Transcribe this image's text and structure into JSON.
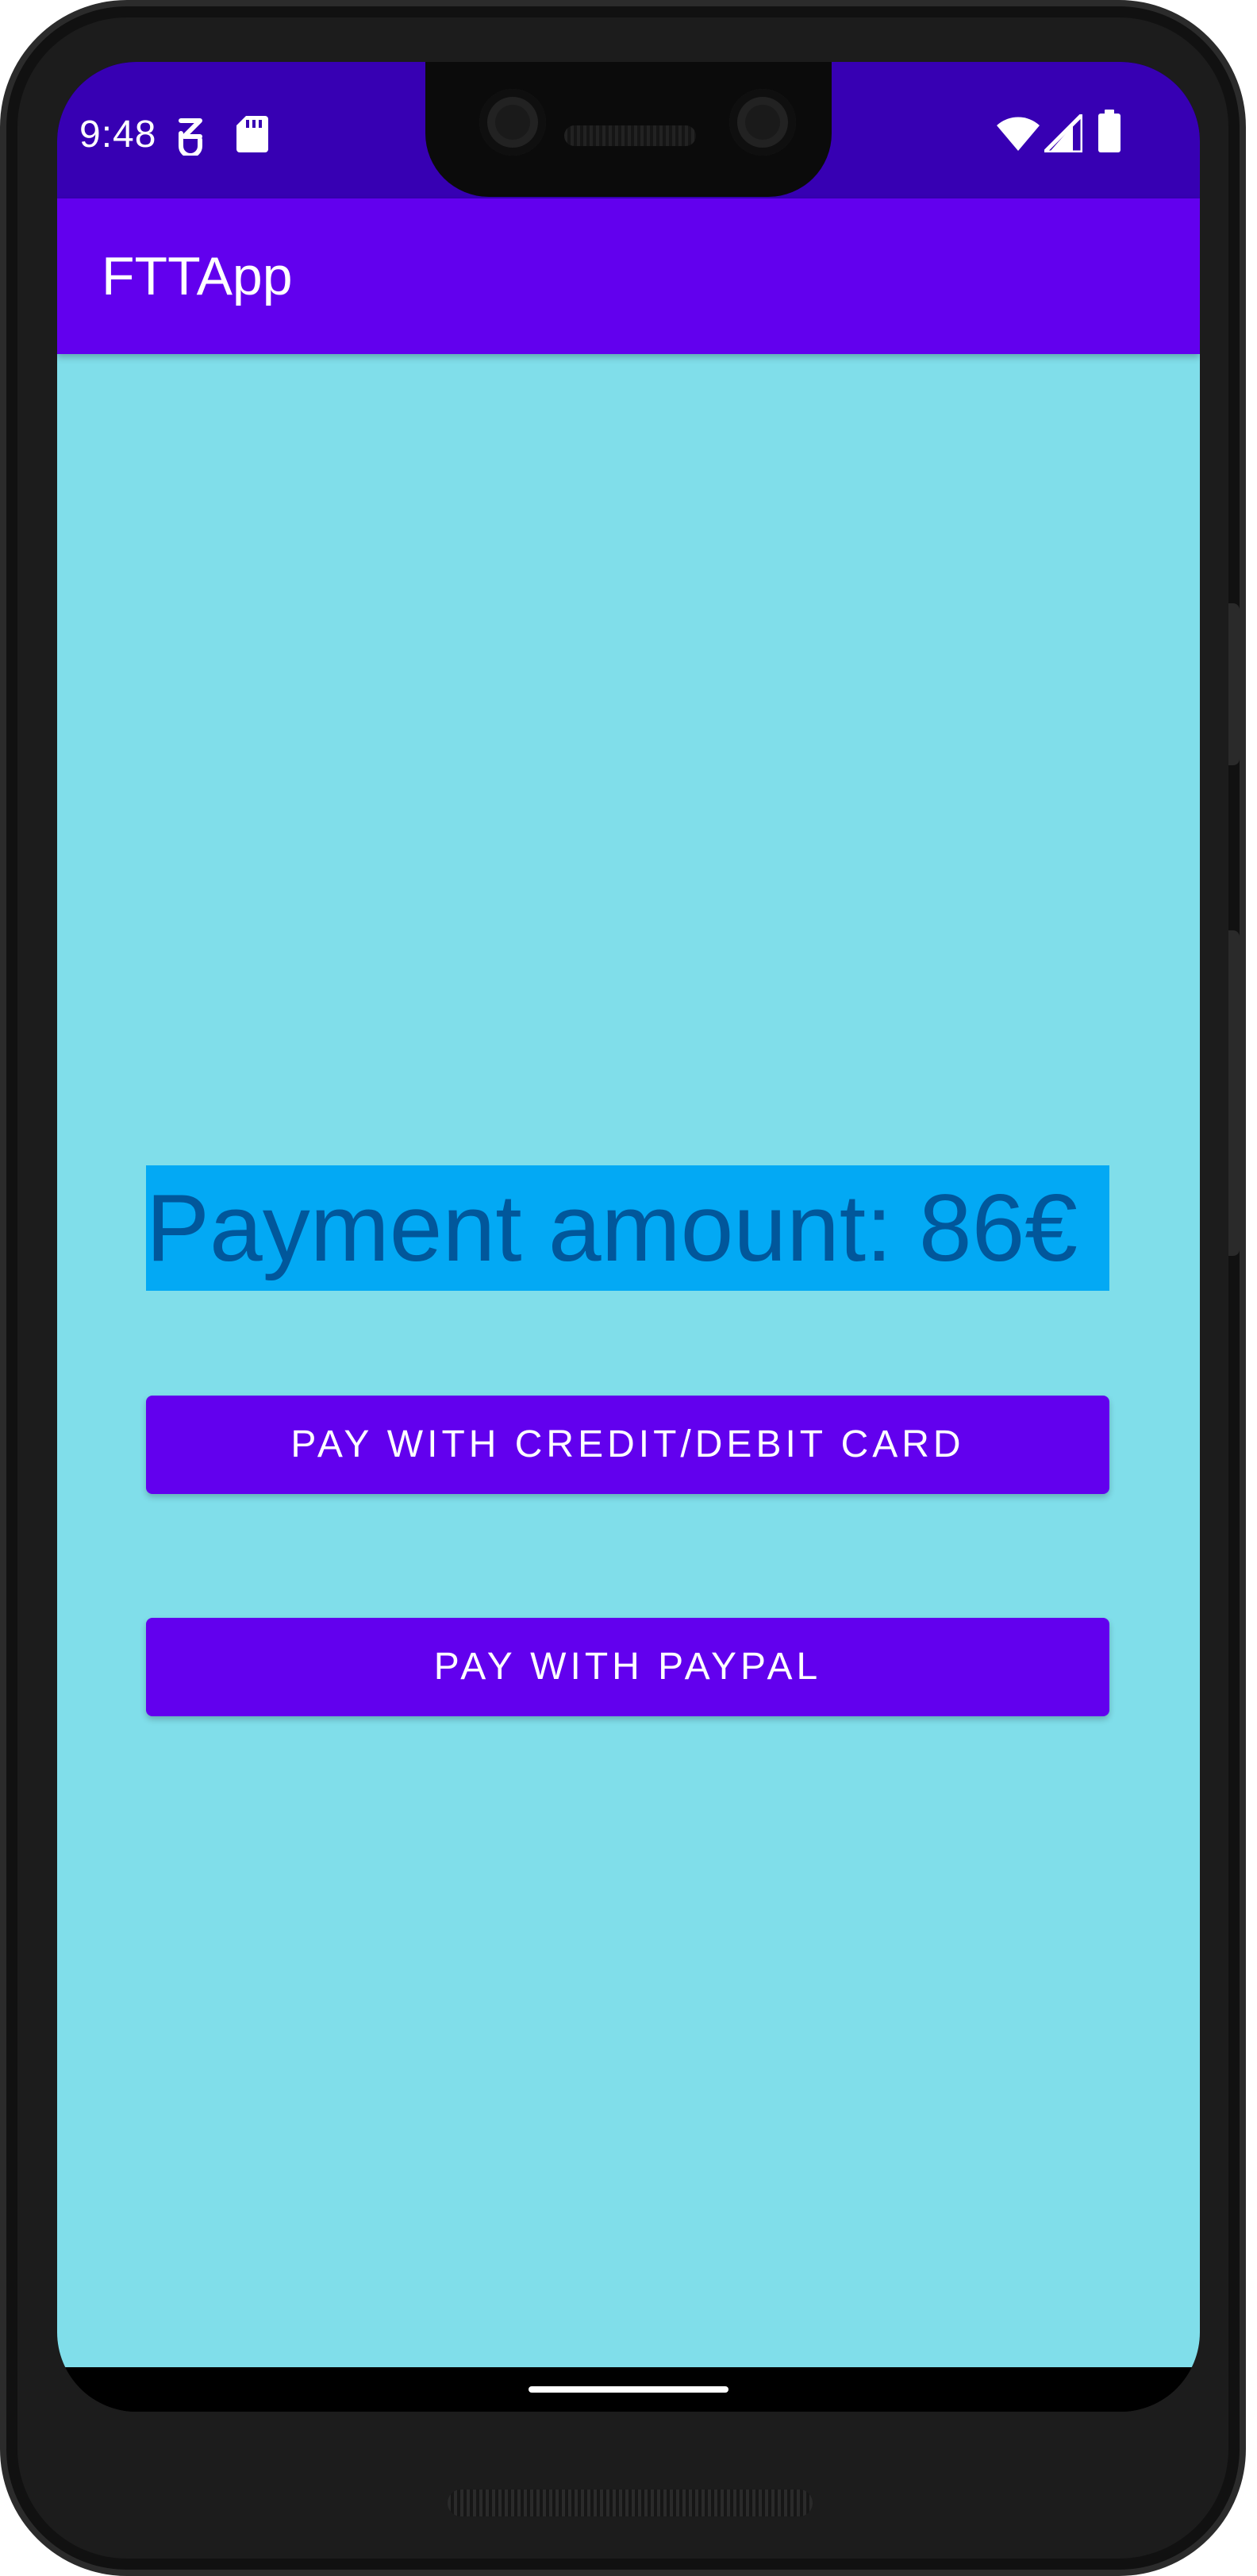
{
  "status_bar": {
    "time": "9:48",
    "icons_left": [
      "data-saver-icon",
      "sd-card-icon"
    ],
    "icons_right": [
      "wifi-icon",
      "cell-signal-icon",
      "battery-icon"
    ],
    "color": "#3700b3"
  },
  "app_bar": {
    "title": "FTTApp",
    "color": "#6200ee"
  },
  "content": {
    "background": "#80deea",
    "amount_label": "Payment amount: 86€",
    "amount_label_background": "#03a9f4",
    "amount_label_color": "#01579b",
    "buttons": [
      {
        "label": "PAY WITH CREDIT/DEBIT CARD"
      },
      {
        "label": "PAY WITH PAYPAL"
      }
    ]
  }
}
